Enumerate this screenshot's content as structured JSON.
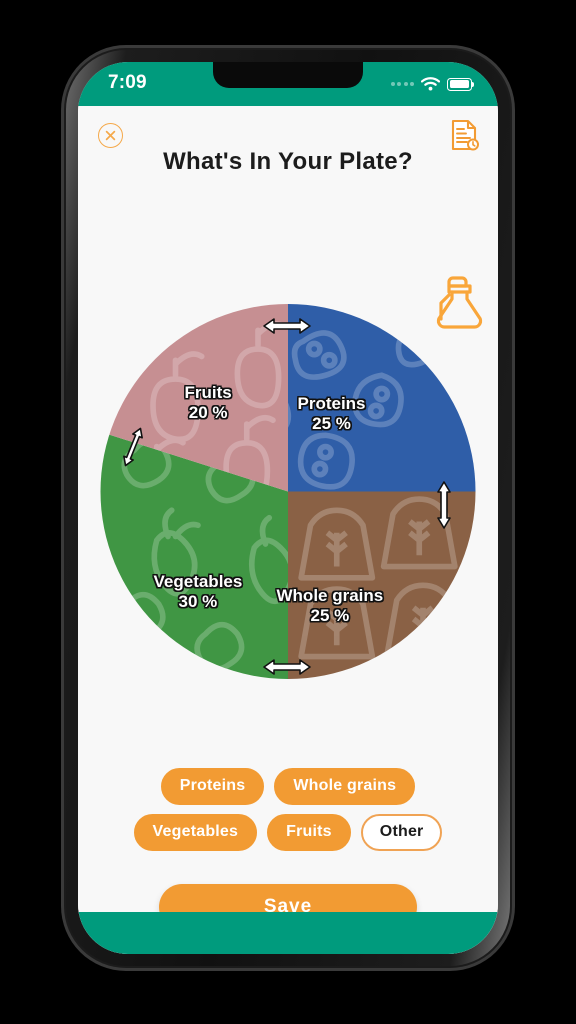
{
  "status_bar": {
    "time": "7:09",
    "wifi_icon": "wifi-icon",
    "battery_icon": "battery-full-icon",
    "signal_icon": "signal-dots-icon",
    "background": "#009b7d"
  },
  "header": {
    "title": "What's In Your Plate?",
    "close_icon": "close-circle-icon",
    "report_icon": "document-report-icon",
    "accent": "#f29b33"
  },
  "decor": {
    "oil_bottle_icon": "oil-bottle-icon"
  },
  "chart_data": {
    "type": "pie",
    "title": "What's In Your Plate?",
    "categories": [
      "Proteins",
      "Whole grains",
      "Vegetables",
      "Fruits"
    ],
    "values": [
      25,
      25,
      30,
      20
    ],
    "unit": "%",
    "labels": [
      "Proteins 25 %",
      "Whole grains 25 %",
      "Vegetables 30 %",
      "Fruits 20 %"
    ],
    "colors": [
      "#2f5ea8",
      "#8a6145",
      "#409644",
      "#c68f92"
    ],
    "start_angle_deg": 0,
    "direction": "clockwise",
    "legend": "none",
    "slices": [
      {
        "name": "Proteins",
        "value": 25,
        "value_label": "25 %",
        "color": "#2f5ea8",
        "texture": "beans-pattern",
        "start_deg": 0,
        "end_deg": 90
      },
      {
        "name": "Whole grains",
        "value": 25,
        "value_label": "25 %",
        "color": "#8a6145",
        "texture": "grain-sack-pattern",
        "start_deg": 90,
        "end_deg": 180
      },
      {
        "name": "Vegetables",
        "value": 30,
        "value_label": "30 %",
        "color": "#409644",
        "texture": "vegetables-pattern",
        "start_deg": 180,
        "end_deg": 288
      },
      {
        "name": "Fruits",
        "value": 20,
        "value_label": "20 %",
        "color": "#c68f92",
        "texture": "fruits-pattern",
        "start_deg": 288,
        "end_deg": 360
      }
    ],
    "handles": [
      {
        "name": "proteins-fruits-handle",
        "orientation": "horizontal"
      },
      {
        "name": "fruits-vegetables-handle",
        "orientation": "diagonal"
      },
      {
        "name": "proteins-grains-handle",
        "orientation": "vertical"
      },
      {
        "name": "vegetables-grains-handle",
        "orientation": "horizontal"
      }
    ]
  },
  "chips": [
    {
      "label": "Proteins",
      "style": "filled"
    },
    {
      "label": "Whole grains",
      "style": "filled"
    },
    {
      "label": "Vegetables",
      "style": "filled"
    },
    {
      "label": "Fruits",
      "style": "filled"
    },
    {
      "label": "Other",
      "style": "outline"
    }
  ],
  "actions": {
    "save_label": "Save"
  }
}
